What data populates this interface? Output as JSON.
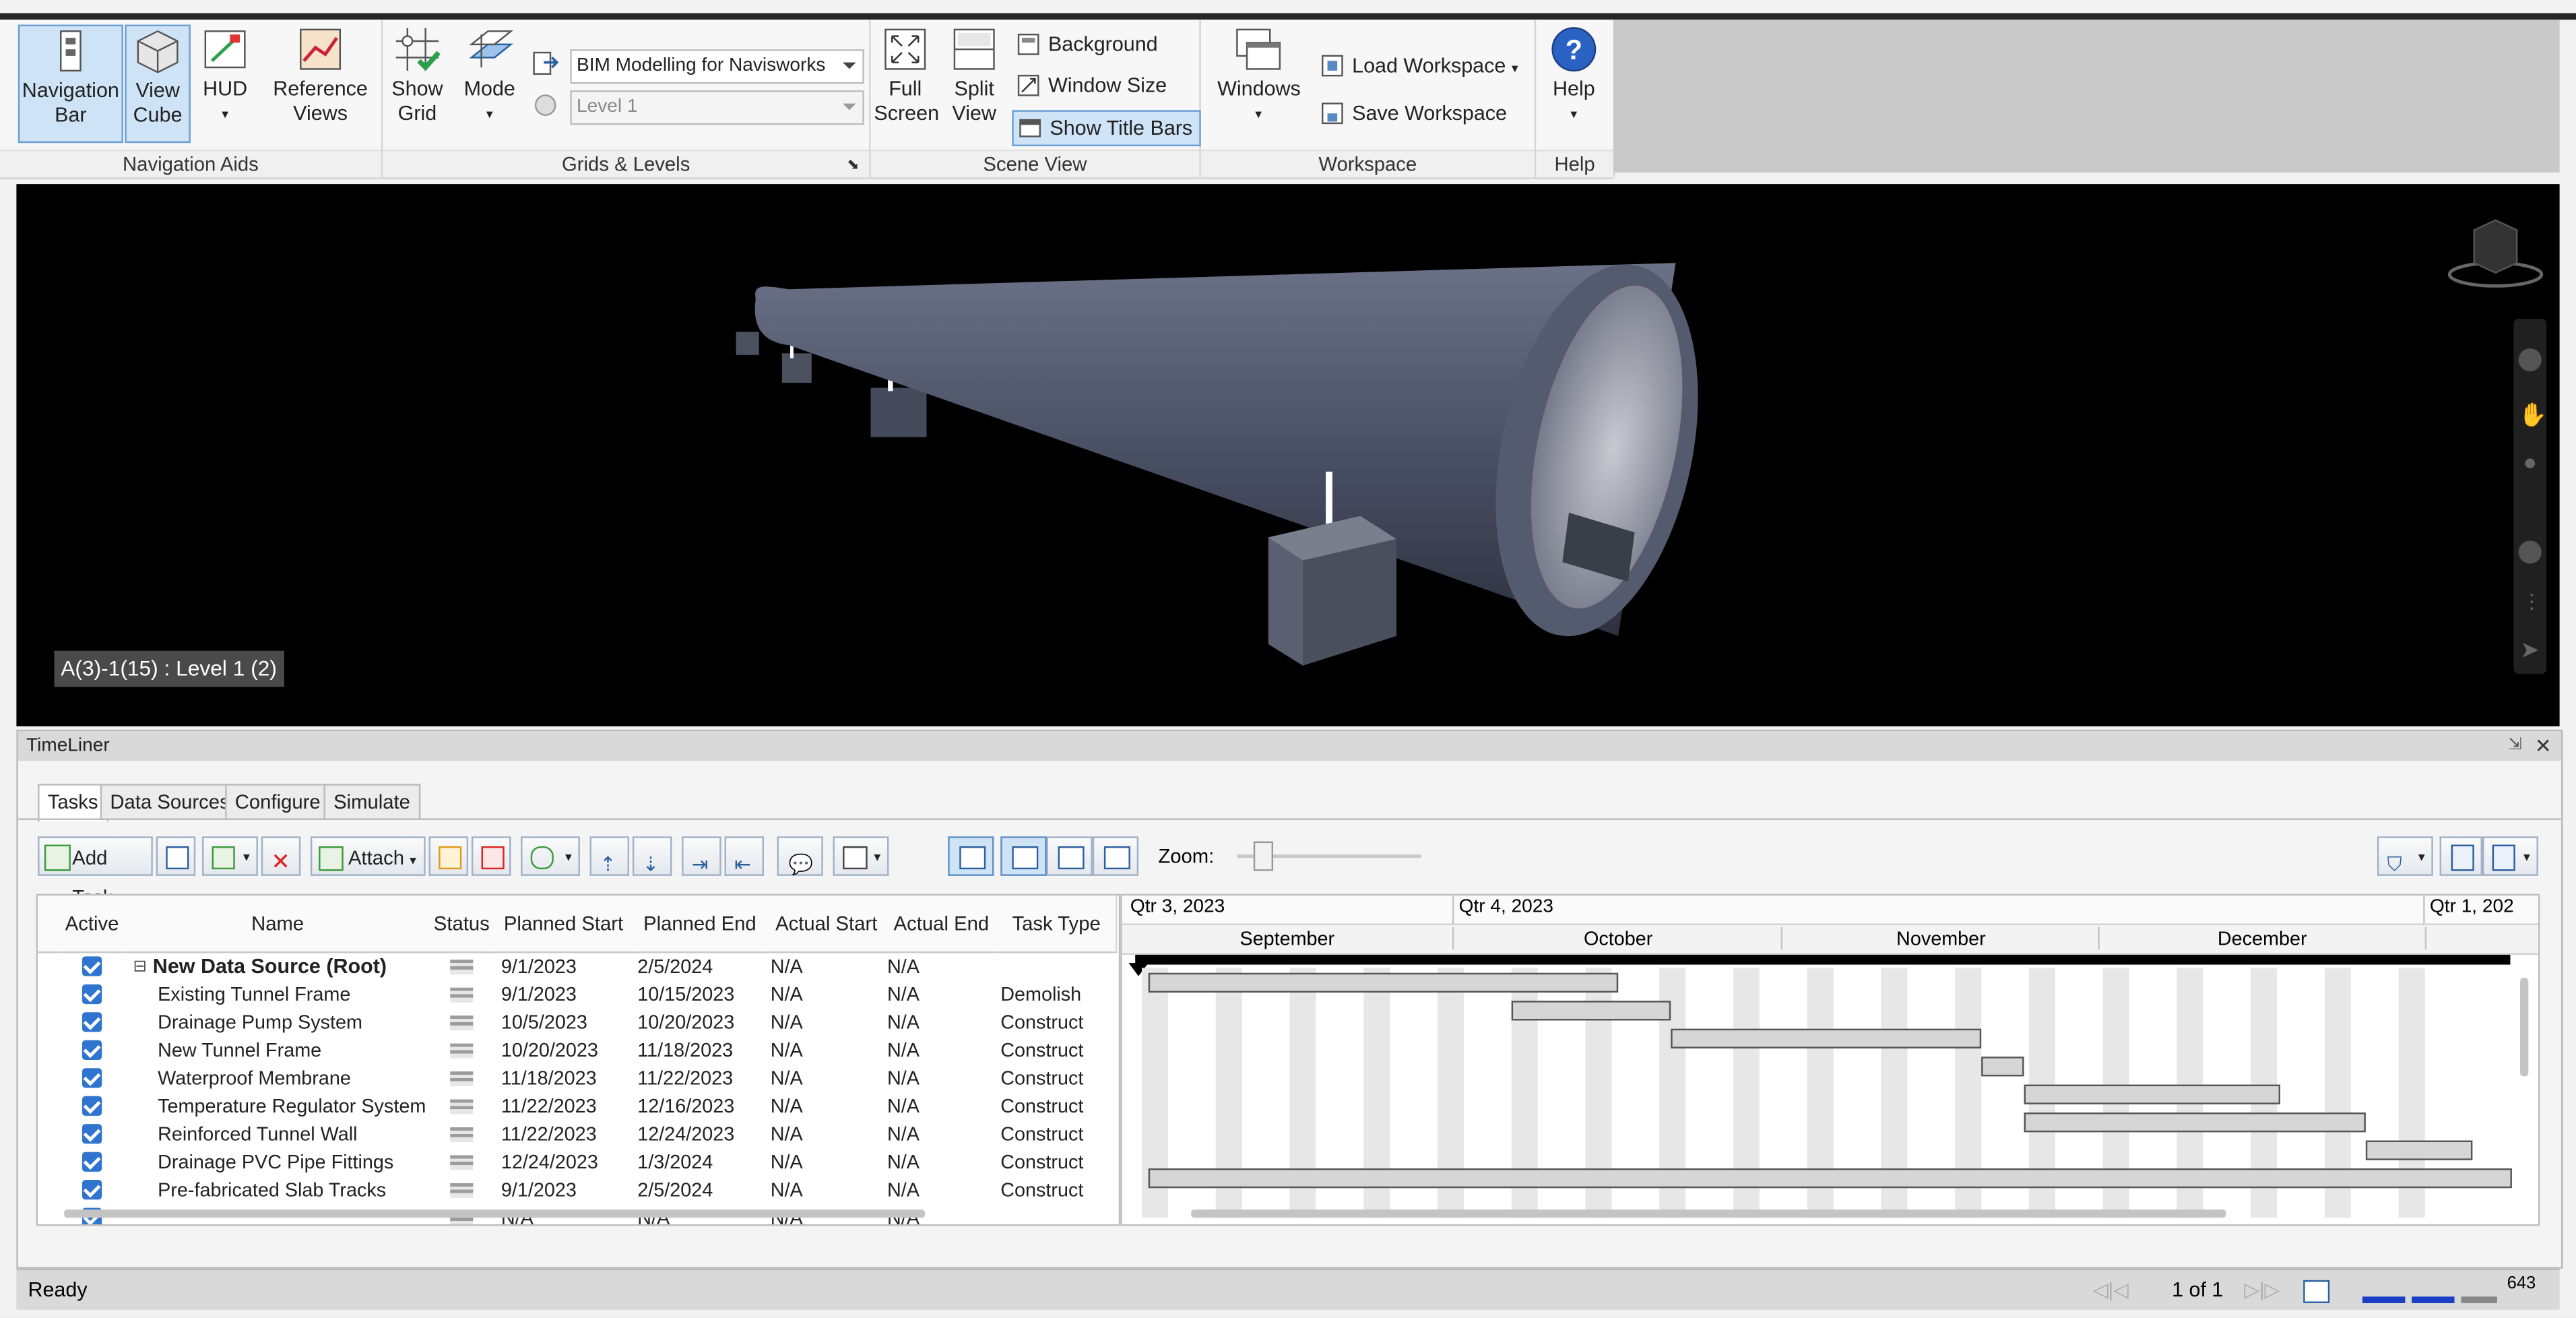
{
  "ribbon": {
    "navigation_aids": {
      "title": "Navigation Aids",
      "navigation_bar": [
        "Navigation",
        "Bar"
      ],
      "view_cube": [
        "View",
        "Cube"
      ],
      "hud": "HUD",
      "reference_views": [
        "Reference",
        "Views"
      ]
    },
    "grids_levels": {
      "title": "Grids & Levels",
      "show_grid": [
        "Show",
        "Grid"
      ],
      "mode": "Mode",
      "grid_combo": "BIM Modelling for Navisworks",
      "level_combo": "Level 1"
    },
    "scene_view": {
      "title": "Scene View",
      "full_screen": [
        "Full",
        "Screen"
      ],
      "split_view": [
        "Split",
        "View"
      ],
      "background": "Background",
      "window_size": "Window Size",
      "show_title_bars": "Show Title Bars"
    },
    "workspace": {
      "title": "Workspace",
      "windows": "Windows",
      "load_workspace": "Load Workspace",
      "save_workspace": "Save Workspace"
    },
    "help": {
      "title": "Help",
      "help": "Help"
    }
  },
  "viewport": {
    "label": "A(3)-1(15) : Level 1 (2)"
  },
  "timeliner": {
    "title": "TimeLiner",
    "tabs": [
      "Tasks",
      "Data Sources",
      "Configure",
      "Simulate"
    ],
    "toolbar": {
      "add_task": "Add Task",
      "attach": "Attach",
      "zoom_label": "Zoom:"
    },
    "columns": [
      "Active",
      "Name",
      "Status",
      "Planned Start",
      "Planned End",
      "Actual Start",
      "Actual End",
      "Task Type"
    ],
    "rows": [
      {
        "name": "New Data Source (Root)",
        "planned_start": "9/1/2023",
        "planned_end": "2/5/2024",
        "actual_start": "N/A",
        "actual_end": "N/A",
        "task_type": ""
      },
      {
        "name": "Existing Tunnel Frame",
        "planned_start": "9/1/2023",
        "planned_end": "10/15/2023",
        "actual_start": "N/A",
        "actual_end": "N/A",
        "task_type": "Demolish"
      },
      {
        "name": "Drainage Pump System",
        "planned_start": "10/5/2023",
        "planned_end": "10/20/2023",
        "actual_start": "N/A",
        "actual_end": "N/A",
        "task_type": "Construct"
      },
      {
        "name": "New Tunnel Frame",
        "planned_start": "10/20/2023",
        "planned_end": "11/18/2023",
        "actual_start": "N/A",
        "actual_end": "N/A",
        "task_type": "Construct"
      },
      {
        "name": "Waterproof Membrane",
        "planned_start": "11/18/2023",
        "planned_end": "11/22/2023",
        "actual_start": "N/A",
        "actual_end": "N/A",
        "task_type": "Construct"
      },
      {
        "name": "Temperature Regulator System",
        "planned_start": "11/22/2023",
        "planned_end": "12/16/2023",
        "actual_start": "N/A",
        "actual_end": "N/A",
        "task_type": "Construct"
      },
      {
        "name": "Reinforced Tunnel Wall",
        "planned_start": "11/22/2023",
        "planned_end": "12/24/2023",
        "actual_start": "N/A",
        "actual_end": "N/A",
        "task_type": "Construct"
      },
      {
        "name": "Drainage PVC Pipe Fittings",
        "planned_start": "12/24/2023",
        "planned_end": "1/3/2024",
        "actual_start": "N/A",
        "actual_end": "N/A",
        "task_type": "Construct"
      },
      {
        "name": "Pre-fabricated Slab Tracks",
        "planned_start": "9/1/2023",
        "planned_end": "2/5/2024",
        "actual_start": "N/A",
        "actual_end": "N/A",
        "task_type": "Construct"
      },
      {
        "name": "",
        "planned_start": "N/A",
        "planned_end": "N/A",
        "actual_start": "N/A",
        "actual_end": "N/A",
        "task_type": ""
      }
    ],
    "gantt": {
      "quarters": [
        "Qtr 3, 2023",
        "Qtr 4, 2023",
        "Qtr 1, 202"
      ],
      "months": [
        "September",
        "October",
        "November",
        "December"
      ],
      "bars": [
        {
          "start": "9/1/2023",
          "end": "10/15/2023"
        },
        {
          "start": "10/5/2023",
          "end": "10/20/2023"
        },
        {
          "start": "10/20/2023",
          "end": "11/18/2023"
        },
        {
          "start": "11/18/2023",
          "end": "11/22/2023"
        },
        {
          "start": "11/22/2023",
          "end": "12/16/2023"
        },
        {
          "start": "11/22/2023",
          "end": "12/24/2023"
        },
        {
          "start": "12/24/2023",
          "end": "1/3/2024"
        },
        {
          "start": "9/1/2023",
          "end": "2/5/2024"
        }
      ]
    }
  },
  "statusbar": {
    "status": "Ready",
    "page": "1 of 1",
    "memory": "643"
  },
  "colors": {
    "selection": "#cfe3f7",
    "check": "#2f74cf",
    "viewport_bg": "#000000",
    "pipe": "#4d5468"
  }
}
